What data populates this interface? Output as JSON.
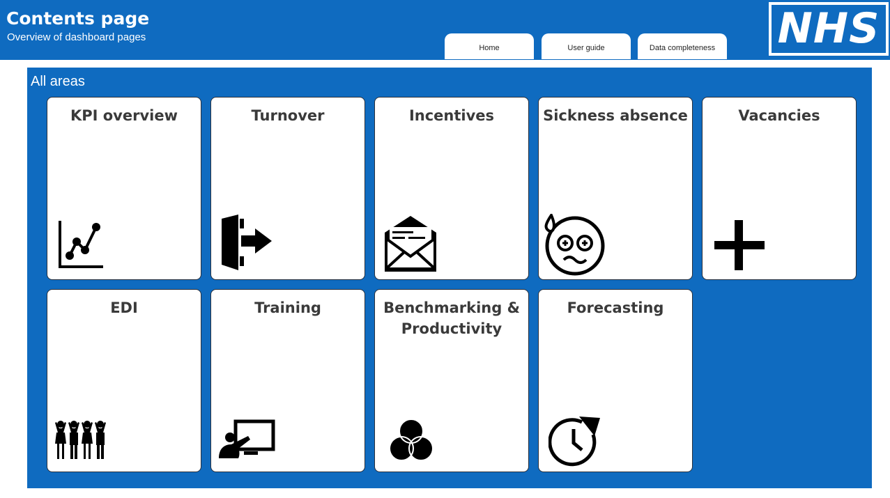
{
  "header": {
    "title": "Contents page",
    "subtitle": "Overview of dashboard pages",
    "nav": [
      "Home",
      "User guide",
      "Data completeness"
    ],
    "logo_text": "NHS"
  },
  "panel": {
    "title": "All areas",
    "tiles": [
      {
        "label": "KPI overview",
        "icon": "line-chart-icon"
      },
      {
        "label": "Turnover",
        "icon": "exit-door-icon"
      },
      {
        "label": "Incentives",
        "icon": "open-envelope-icon"
      },
      {
        "label": "Sickness absence",
        "icon": "sick-face-icon"
      },
      {
        "label": "Vacancies",
        "icon": "plus-icon"
      },
      {
        "label": "EDI",
        "icon": "group-of-people-icon"
      },
      {
        "label": "Training",
        "icon": "presentation-icon"
      },
      {
        "label": "Benchmarking & Productivity",
        "icon": "venn-diagram-icon"
      },
      {
        "label": "Forecasting",
        "icon": "clock-refresh-icon"
      }
    ]
  },
  "colors": {
    "brand_blue": "#0f6bc0",
    "tile_bg": "#ffffff",
    "title_text": "#3a3a3a"
  }
}
